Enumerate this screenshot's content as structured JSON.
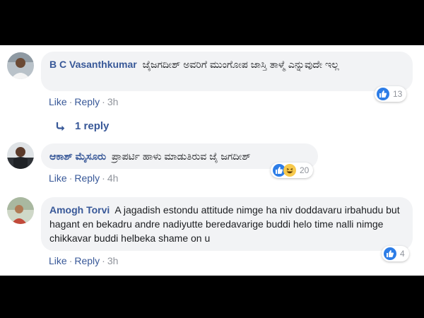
{
  "comments": [
    {
      "author": "B C Vasanthkumar",
      "text": "ಜೈಜಗದೀಶ್ ಅವರಿಗೆ ಮುಂಗೋಪ ಜಾಸ್ತಿ ತಾಳ್ಮೆ ಎನ್ನುವುದೇ ಇಲ್ಲ",
      "like_label": "Like",
      "reply_label": "Reply",
      "time": "3h",
      "reaction_count": "13",
      "reactions": [
        "like"
      ]
    },
    {
      "author": "ಆಕಾಶ್ ಮೈಸೂರು",
      "text": "ಪ್ರಾಪರ್ಟಿ ಹಾಳು ಮಾಡುತಿರುವ ಜೈ ಜಗದೀಶ್",
      "like_label": "Like",
      "reply_label": "Reply",
      "time": "4h",
      "reaction_count": "20",
      "reactions": [
        "like",
        "haha"
      ]
    },
    {
      "author": "Amogh Torvi",
      "text": "A jagadish estondu attitude nimge ha niv doddavaru irbahudu but hagant en bekadru andre nadiyutte beredavarige buddi helo time nalli nimge chikkavar buddi helbeka shame on u",
      "like_label": "Like",
      "reply_label": "Reply",
      "time": "3h",
      "reaction_count": "4",
      "reactions": [
        "like"
      ]
    }
  ],
  "replies_link": "1 reply",
  "colors": {
    "link": "#385898",
    "bubble": "#f2f3f5",
    "like_blue": "#2d7de7",
    "haha_yellow": "#f7c94c",
    "frame_black": "#000000"
  },
  "icons": [
    "thumbs-up-icon",
    "haha-icon",
    "reply-arrow-icon",
    "avatar"
  ]
}
